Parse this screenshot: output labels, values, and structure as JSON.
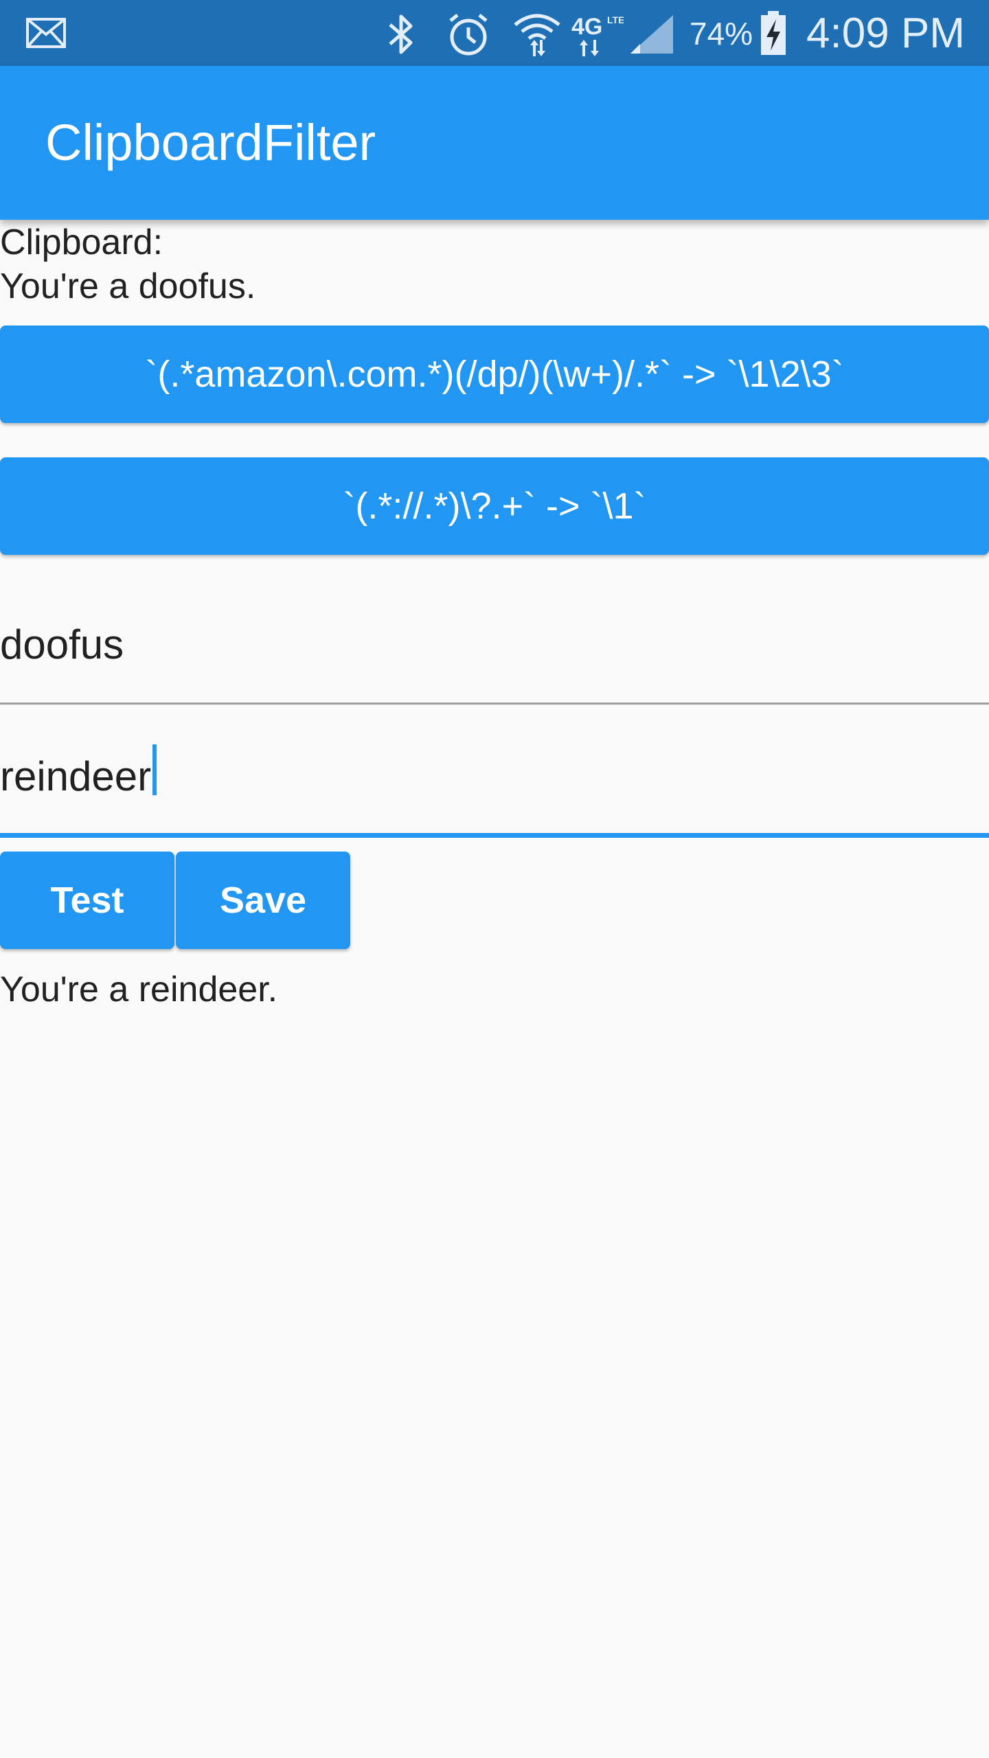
{
  "status_bar": {
    "battery_percent": "74%",
    "time": "4:09 PM",
    "icons": [
      "mail-icon",
      "bluetooth-icon",
      "alarm-icon",
      "wifi-icon",
      "4g-lte-icon",
      "signal-icon",
      "battery-charging-icon"
    ]
  },
  "app_bar": {
    "title": "ClipboardFilter"
  },
  "clipboard": {
    "label": "Clipboard:",
    "value": "You're a doofus."
  },
  "rules": [
    {
      "label": "`(.*amazon\\.com.*)(/dp/)(\\w+)/.*` -> `\\1\\2\\3`"
    },
    {
      "label": "`(.*://.*)\\?.+` -> `\\1`"
    }
  ],
  "find_field": {
    "value": "doofus"
  },
  "replace_field": {
    "value": "reindeer"
  },
  "actions": {
    "test_label": "Test",
    "save_label": "Save"
  },
  "result": {
    "text": "You're a reindeer."
  },
  "colors": {
    "primary": "#2196f3",
    "status_bar": "#1f6fb5",
    "background": "#fafafa"
  }
}
